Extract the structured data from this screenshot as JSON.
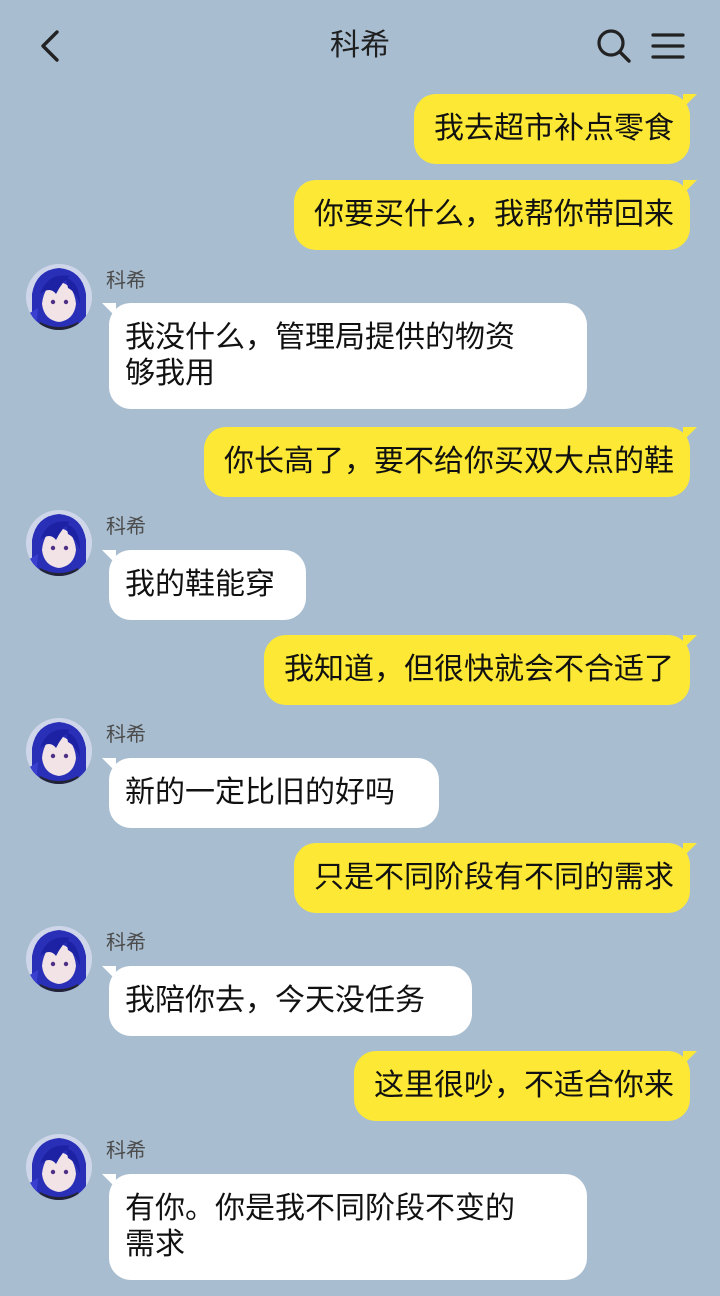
{
  "header": {
    "title": "科希"
  },
  "contact": {
    "name": "科希"
  },
  "messages": [
    {
      "side": "me",
      "text": "我去超市补点零食"
    },
    {
      "side": "me",
      "text": "你要买什么，我帮你带回来"
    },
    {
      "side": "them",
      "sender": "科希",
      "lines": [
        "我没什么，管理局提供的物资",
        "够我用"
      ]
    },
    {
      "side": "me",
      "text": "你长高了，要不给你买双大点的鞋"
    },
    {
      "side": "them",
      "sender": "科希",
      "lines": [
        "我的鞋能穿"
      ]
    },
    {
      "side": "me",
      "text": "我知道，但很快就会不合适了"
    },
    {
      "side": "them",
      "sender": "科希",
      "lines": [
        "新的一定比旧的好吗"
      ]
    },
    {
      "side": "me",
      "text": "只是不同阶段有不同的需求"
    },
    {
      "side": "them",
      "sender": "科希",
      "lines": [
        "我陪你去，今天没任务"
      ]
    },
    {
      "side": "me",
      "text": "这里很吵，不适合你来"
    },
    {
      "side": "them",
      "sender": "科希",
      "lines": [
        "有你。你是我不同阶段不变的",
        "需求"
      ]
    }
  ],
  "icons": {
    "back": "chevron-left-icon",
    "search": "search-icon",
    "menu": "menu-icon"
  },
  "colors": {
    "background": "#a8bdd0",
    "my_bubble": "#fde935",
    "their_bubble": "#ffffff"
  }
}
